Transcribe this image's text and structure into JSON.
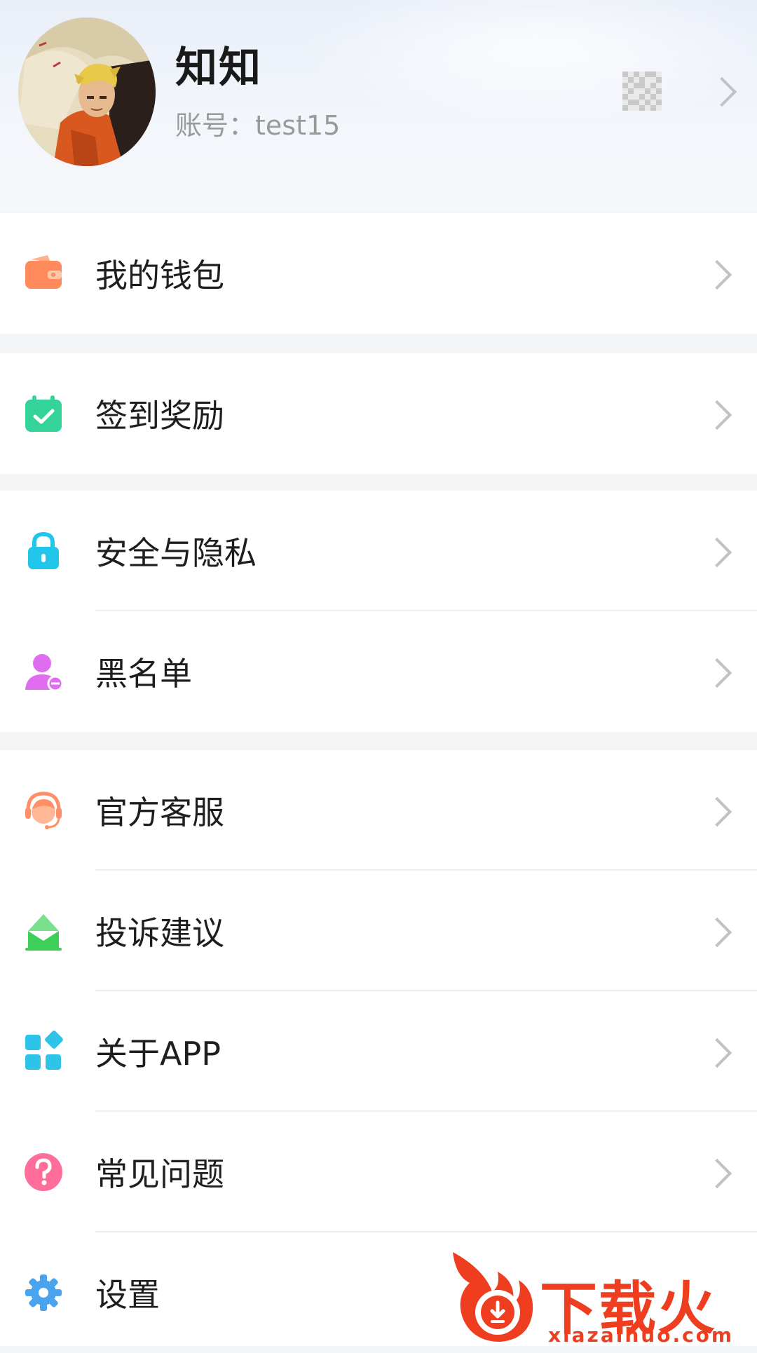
{
  "profile": {
    "nickname": "知知",
    "account_label": "账号：",
    "account_value": "test15",
    "avatar_icon": "avatar-image",
    "qr_icon": "qr-code-icon"
  },
  "menu": {
    "wallet": {
      "label": "我的钱包",
      "icon": "wallet-icon",
      "color": "#ff8a5b"
    },
    "checkin": {
      "label": "签到奖励",
      "icon": "calendar-check-icon",
      "color": "#34d399"
    },
    "security": {
      "label": "安全与隐私",
      "icon": "lock-icon",
      "color": "#22c6ea"
    },
    "blacklist": {
      "label": "黑名单",
      "icon": "user-block-icon",
      "color": "#e06cf0"
    },
    "support": {
      "label": "官方客服",
      "icon": "headset-icon",
      "color": "#ff8f66"
    },
    "feedback": {
      "label": "投诉建议",
      "icon": "envelope-icon",
      "color": "#3ecf5a"
    },
    "about": {
      "label": "关于APP",
      "icon": "apps-icon",
      "color": "#2ec4ea"
    },
    "faq": {
      "label": "常见问题",
      "icon": "question-icon",
      "color": "#ff6e9a"
    },
    "settings": {
      "label": "设置",
      "icon": "gear-icon",
      "color": "#4aa3ef"
    }
  },
  "watermark": {
    "title": "下载火",
    "url": "xiazaihuo.com",
    "color": "#ef3e1f"
  }
}
